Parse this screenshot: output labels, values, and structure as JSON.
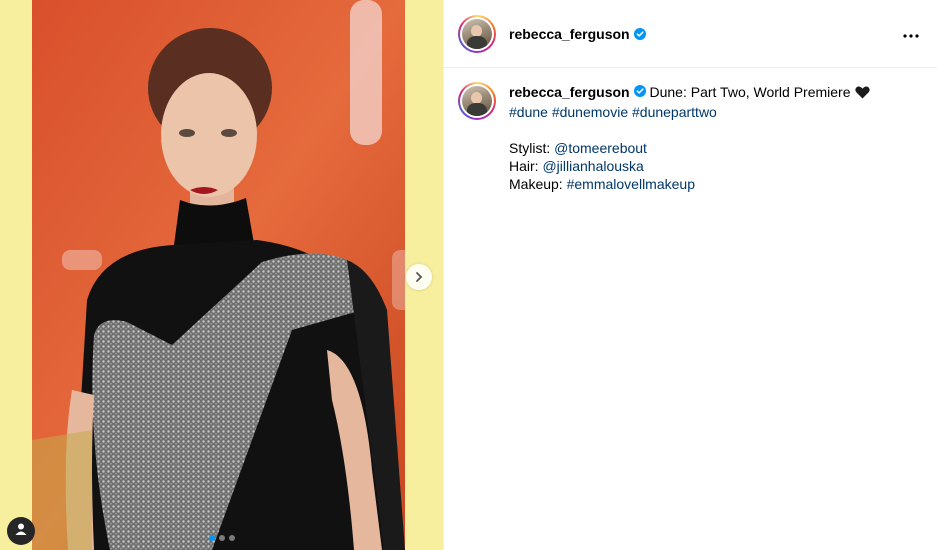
{
  "post": {
    "author": "rebecca_ferguson",
    "verified": true,
    "caption_text": "Dune: Part Two, World Premiere",
    "caption_emoji": "black-heart",
    "hashtags": [
      "#dune",
      "#dunemovie",
      "#duneparttwo"
    ],
    "credits": [
      {
        "label": "Stylist: ",
        "handle": "@tomeerebout",
        "handle_type": "mention"
      },
      {
        "label": "Hair: ",
        "handle": "@jillianhalouska",
        "handle_type": "mention"
      },
      {
        "label": "Makeup: ",
        "handle": "#emmalovellmakeup",
        "handle_type": "hashtag"
      }
    ]
  },
  "media": {
    "carousel_count": 3,
    "carousel_active_index": 0
  },
  "colors": {
    "link": "#00376b",
    "verified_badge": "#0095f6",
    "border": "#efefef",
    "media_backdrop": "#f7ee9e",
    "photo_background": "#e2572c"
  },
  "icons": {
    "more": "three-dots-icon",
    "verified": "verified-badge-icon",
    "next": "chevron-right-icon",
    "tag": "person-tag-icon"
  }
}
